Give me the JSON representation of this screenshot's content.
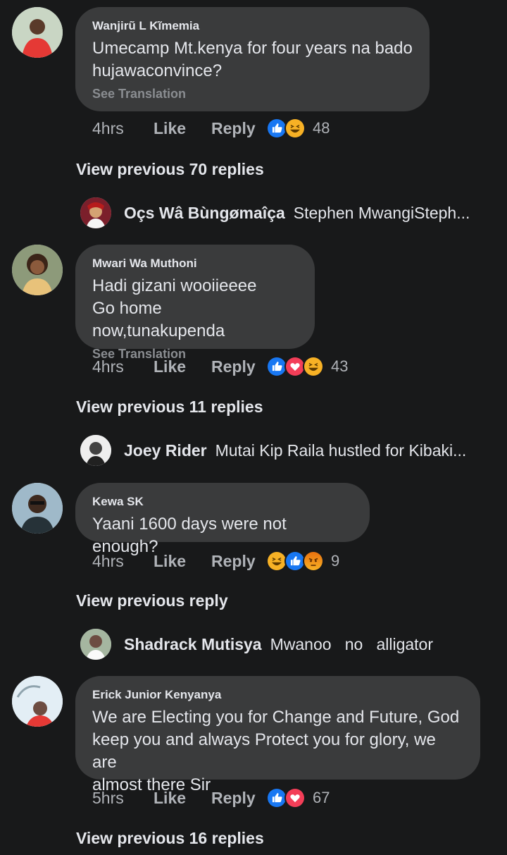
{
  "comments": [
    {
      "author": "Wanjirũ L Kĩmemia",
      "text_lines": [
        "Umecamp Mt.kenya for four years na bado",
        "hujawaconvince?"
      ],
      "see_translation": "See Translation",
      "time": "4hrs",
      "like_label": "Like",
      "reply_label": "Reply",
      "reactions": [
        "like",
        "haha"
      ],
      "reaction_count": "48",
      "view_previous": "View previous 70 replies",
      "preview": {
        "name": "Oçs Wâ Bùngømaîça",
        "text": "Stephen MwangiSteph..."
      }
    },
    {
      "author": "Mwari Wa Muthoni",
      "text_lines": [
        "Hadi gizani wooiieeee",
        "Go home now,tunakupenda"
      ],
      "see_translation": "See Translation",
      "time": "4hrs",
      "like_label": "Like",
      "reply_label": "Reply",
      "reactions": [
        "like",
        "love",
        "haha"
      ],
      "reaction_count": "43",
      "view_previous": "View previous 11 replies",
      "preview": {
        "name": "Joey Rider",
        "text": "Mutai Kip Raila hustled for Kibaki..."
      }
    },
    {
      "author": "Kewa SK",
      "text_lines": [
        "Yaani 1600 days were not enough?"
      ],
      "time": "4hrs",
      "like_label": "Like",
      "reply_label": "Reply",
      "reactions": [
        "haha",
        "like",
        "angry"
      ],
      "reaction_count": "9",
      "view_previous": "View previous reply",
      "preview": {
        "name": "Shadrack Mutisya",
        "text": "Mwanoo   no   alligator"
      }
    },
    {
      "author": "Erick Junior Kenyanya",
      "text_lines": [
        "We are Electing you for Change and Future, God",
        "keep you and always Protect you for glory, we are",
        "almost there Sir"
      ],
      "time": "5hrs",
      "like_label": "Like",
      "reply_label": "Reply",
      "reactions": [
        "like",
        "love"
      ],
      "reaction_count": "67",
      "view_previous": "View previous 16 replies"
    }
  ],
  "colors": {
    "background": "#18191a",
    "bubble": "#3a3b3c",
    "text_primary": "#e4e6eb",
    "text_secondary": "#b0b3b8",
    "like_blue": "#1877f2",
    "love_red": "#f33e58",
    "haha_yellow": "#f7b125",
    "angry_orange": "#e9710f"
  }
}
